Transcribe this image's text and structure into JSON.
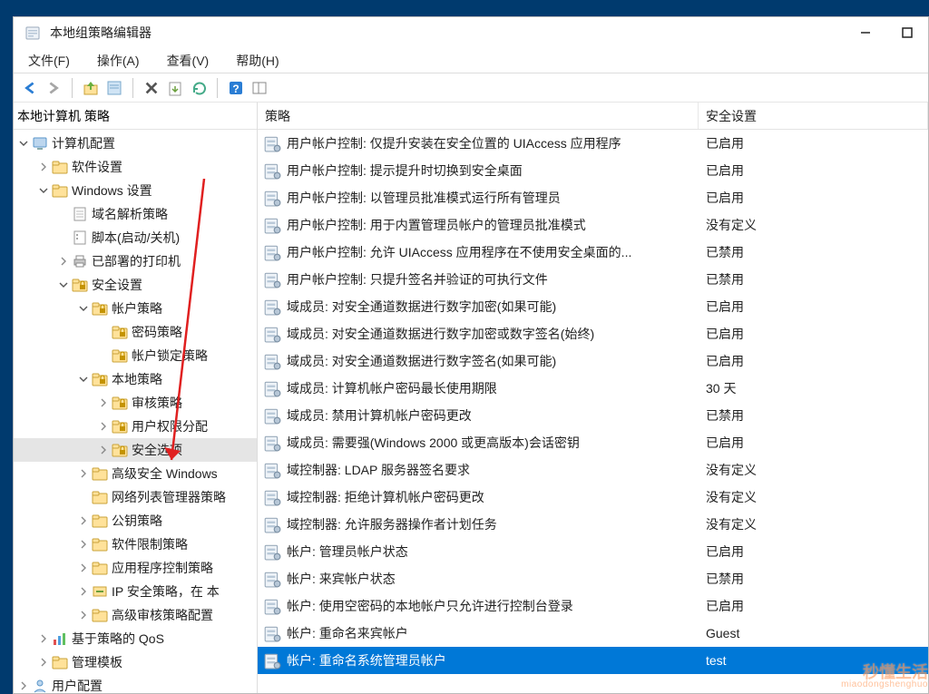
{
  "title": "本地组策略编辑器",
  "menu": {
    "file": "文件(F)",
    "action": "操作(A)",
    "view": "查看(V)",
    "help": "帮助(H)"
  },
  "sidebar_header": "本地计算机 策略",
  "columns": {
    "policy": "策略",
    "setting": "安全设置"
  },
  "tree": [
    {
      "indent": 0,
      "twist": "open",
      "icon": "computer",
      "label": "计算机配置"
    },
    {
      "indent": 1,
      "twist": "closed",
      "icon": "folder",
      "label": "软件设置"
    },
    {
      "indent": 1,
      "twist": "open",
      "icon": "folder",
      "label": "Windows 设置"
    },
    {
      "indent": 2,
      "twist": "none",
      "icon": "doc",
      "label": "域名解析策略"
    },
    {
      "indent": 2,
      "twist": "none",
      "icon": "script",
      "label": "脚本(启动/关机)"
    },
    {
      "indent": 2,
      "twist": "closed",
      "icon": "printer",
      "label": "已部署的打印机"
    },
    {
      "indent": 2,
      "twist": "open",
      "icon": "lockfolder",
      "label": "安全设置"
    },
    {
      "indent": 3,
      "twist": "open",
      "icon": "lockfolder",
      "label": "帐户策略"
    },
    {
      "indent": 4,
      "twist": "none",
      "icon": "lockfolder",
      "label": "密码策略"
    },
    {
      "indent": 4,
      "twist": "none",
      "icon": "lockfolder",
      "label": "帐户锁定策略"
    },
    {
      "indent": 3,
      "twist": "open",
      "icon": "lockfolder",
      "label": "本地策略"
    },
    {
      "indent": 4,
      "twist": "closed",
      "icon": "lockfolder",
      "label": "审核策略"
    },
    {
      "indent": 4,
      "twist": "closed",
      "icon": "lockfolder",
      "label": "用户权限分配"
    },
    {
      "indent": 4,
      "twist": "closed",
      "icon": "lockfolder",
      "label": "安全选项",
      "selected": true
    },
    {
      "indent": 3,
      "twist": "closed",
      "icon": "folder",
      "label": "高级安全 Windows"
    },
    {
      "indent": 3,
      "twist": "none",
      "icon": "folder",
      "label": "网络列表管理器策略"
    },
    {
      "indent": 3,
      "twist": "closed",
      "icon": "folder",
      "label": "公钥策略"
    },
    {
      "indent": 3,
      "twist": "closed",
      "icon": "folder",
      "label": "软件限制策略"
    },
    {
      "indent": 3,
      "twist": "closed",
      "icon": "folder",
      "label": "应用程序控制策略"
    },
    {
      "indent": 3,
      "twist": "closed",
      "icon": "ipsec",
      "label": "IP 安全策略，在 本"
    },
    {
      "indent": 3,
      "twist": "closed",
      "icon": "folder",
      "label": "高级审核策略配置"
    },
    {
      "indent": 1,
      "twist": "closed",
      "icon": "qos",
      "label": "基于策略的 QoS"
    },
    {
      "indent": 1,
      "twist": "closed",
      "icon": "folder",
      "label": "管理模板"
    },
    {
      "indent": 0,
      "twist": "closed",
      "icon": "user",
      "label": "用户配置"
    }
  ],
  "policies": [
    {
      "name": "用户帐户控制: 仅提升安装在安全位置的 UIAccess 应用程序",
      "setting": "已启用"
    },
    {
      "name": "用户帐户控制: 提示提升时切换到安全桌面",
      "setting": "已启用"
    },
    {
      "name": "用户帐户控制: 以管理员批准模式运行所有管理员",
      "setting": "已启用"
    },
    {
      "name": "用户帐户控制: 用于内置管理员帐户的管理员批准模式",
      "setting": "没有定义"
    },
    {
      "name": "用户帐户控制: 允许 UIAccess 应用程序在不使用安全桌面的...",
      "setting": "已禁用"
    },
    {
      "name": "用户帐户控制: 只提升签名并验证的可执行文件",
      "setting": "已禁用"
    },
    {
      "name": "域成员: 对安全通道数据进行数字加密(如果可能)",
      "setting": "已启用"
    },
    {
      "name": "域成员: 对安全通道数据进行数字加密或数字签名(始终)",
      "setting": "已启用"
    },
    {
      "name": "域成员: 对安全通道数据进行数字签名(如果可能)",
      "setting": "已启用"
    },
    {
      "name": "域成员: 计算机帐户密码最长使用期限",
      "setting": "30 天"
    },
    {
      "name": "域成员: 禁用计算机帐户密码更改",
      "setting": "已禁用"
    },
    {
      "name": "域成员: 需要强(Windows 2000 或更高版本)会话密钥",
      "setting": "已启用"
    },
    {
      "name": "域控制器: LDAP 服务器签名要求",
      "setting": "没有定义"
    },
    {
      "name": "域控制器: 拒绝计算机帐户密码更改",
      "setting": "没有定义"
    },
    {
      "name": "域控制器: 允许服务器操作者计划任务",
      "setting": "没有定义"
    },
    {
      "name": "帐户: 管理员帐户状态",
      "setting": "已启用"
    },
    {
      "name": "帐户: 来宾帐户状态",
      "setting": "已禁用"
    },
    {
      "name": "帐户: 使用空密码的本地帐户只允许进行控制台登录",
      "setting": "已启用"
    },
    {
      "name": "帐户: 重命名来宾帐户",
      "setting": "Guest"
    },
    {
      "name": "帐户: 重命名系统管理员帐户",
      "setting": "test",
      "selected": true
    }
  ],
  "watermark": {
    "top": "秒懂生活",
    "bottom": "miaodongshenghuo"
  }
}
